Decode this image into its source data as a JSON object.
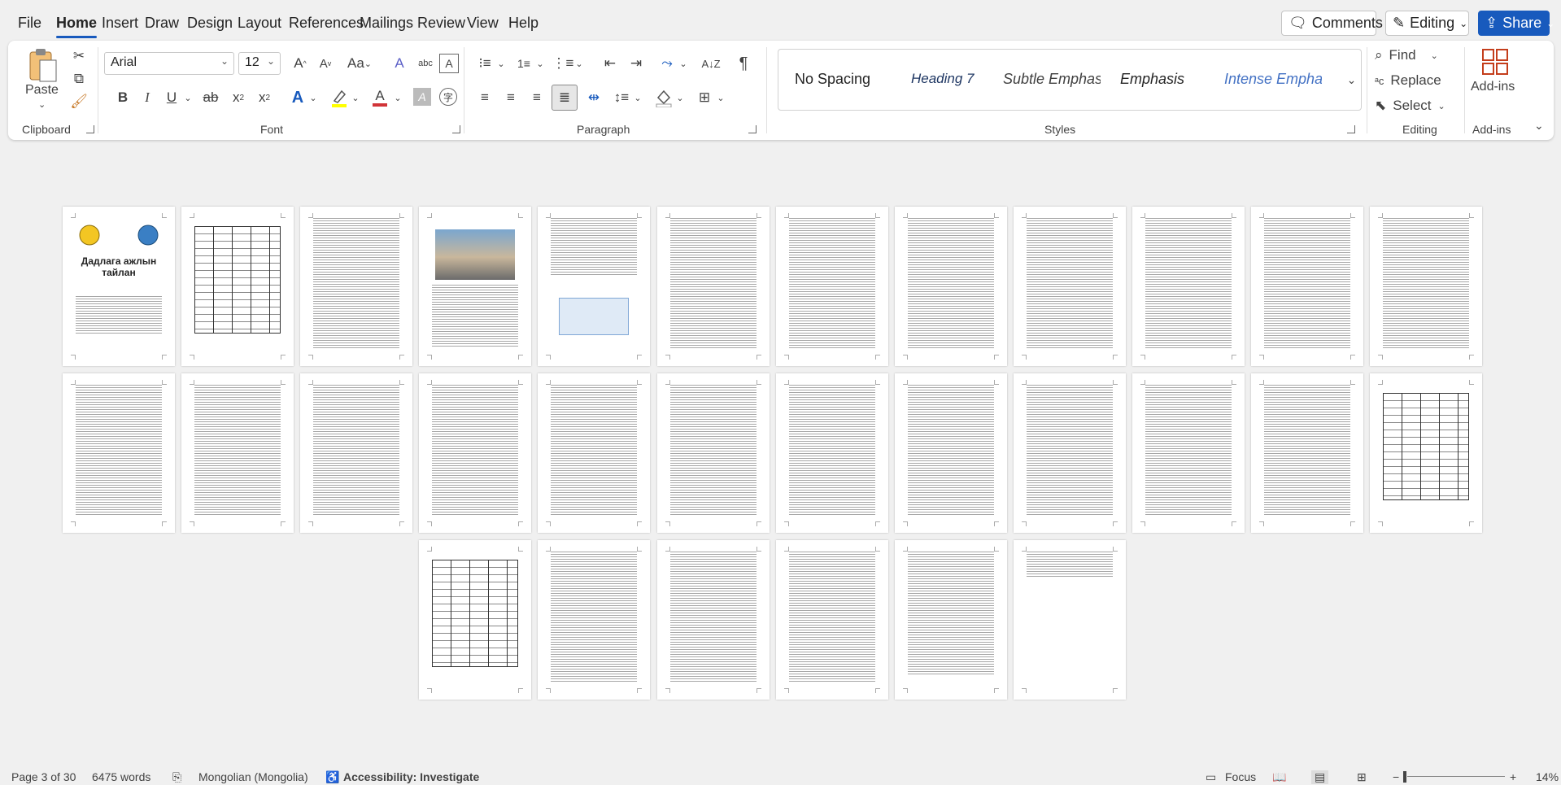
{
  "menu": {
    "tabs": [
      "File",
      "Home",
      "Insert",
      "Draw",
      "Design",
      "Layout",
      "References",
      "Mailings",
      "Review",
      "View",
      "Help"
    ],
    "active_tab": "Home",
    "comments_label": "Comments",
    "editing_label": "Editing",
    "share_label": "Share"
  },
  "ribbon": {
    "clipboard": {
      "paste_label": "Paste",
      "group_label": "Clipboard"
    },
    "font": {
      "name": "Arial",
      "size": "12",
      "group_label": "Font",
      "case_label": "Aa",
      "bold": "B",
      "italic": "I",
      "underline": "U",
      "strike": "ab",
      "subscript": "x",
      "superscript": "x",
      "sub_mark": "2",
      "sup_mark": "2",
      "grow": "A",
      "shrink": "A",
      "text_effects": "A",
      "font_color": "A",
      "clear_format": "A",
      "char_shading": "A",
      "highlight_color": "#ffff00",
      "font_color_swatch": "#d13438"
    },
    "paragraph": {
      "group_label": "Paragraph"
    },
    "styles": {
      "group_label": "Styles",
      "items": [
        "No Spacing",
        "Heading 7",
        "Subtle Emphas",
        "Emphasis",
        "Intense Empha"
      ]
    },
    "editing": {
      "group_label": "Editing",
      "find_label": "Find",
      "replace_label": "Replace",
      "select_label": "Select"
    },
    "addins": {
      "label": "Add-ins",
      "group_label": "Add-ins"
    }
  },
  "document": {
    "cover_title": "Дадлага ажлын тайлан",
    "page_count": 30
  },
  "status": {
    "page": "Page 3 of 30",
    "words": "6475 words",
    "language": "Mongolian (Mongolia)",
    "accessibility": "Accessibility: Investigate",
    "focus_label": "Focus",
    "zoom": "14%"
  },
  "colors": {
    "accent": "#185abd",
    "add_ins": "#c43e1c"
  }
}
